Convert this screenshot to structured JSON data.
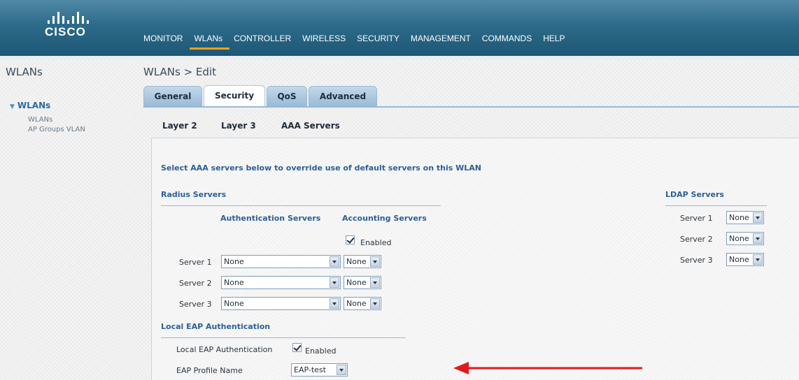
{
  "brand": {
    "logo_text": "CISCO"
  },
  "nav": [
    {
      "label": "MONITOR"
    },
    {
      "label": "WLANs",
      "active": true
    },
    {
      "label": "CONTROLLER"
    },
    {
      "label": "WIRELESS"
    },
    {
      "label": "SECURITY"
    },
    {
      "label": "MANAGEMENT"
    },
    {
      "label": "COMMANDS"
    },
    {
      "label": "HELP"
    }
  ],
  "sidebar": {
    "title": "WLANs",
    "group_label": "WLANs",
    "items": [
      {
        "label": "WLANs"
      },
      {
        "label": "AP Groups VLAN"
      }
    ]
  },
  "page": {
    "title": "WLANs > Edit"
  },
  "tabs": [
    {
      "label": "General"
    },
    {
      "label": "Security",
      "active": true
    },
    {
      "label": "QoS"
    },
    {
      "label": "Advanced"
    }
  ],
  "subtabs": [
    {
      "label": "Layer 2"
    },
    {
      "label": "Layer 3"
    },
    {
      "label": "AAA Servers",
      "active": true
    }
  ],
  "aaa": {
    "intro": "Select AAA servers below to override use of default servers on this WLAN",
    "radius_heading": "Radius Servers",
    "auth_header": "Authentication Servers",
    "acct_header": "Accounting Servers",
    "acct_enabled_label": "Enabled",
    "radius_rows": [
      {
        "label": "Server 1",
        "auth": "None",
        "acct": "None"
      },
      {
        "label": "Server 2",
        "auth": "None",
        "acct": "None"
      },
      {
        "label": "Server 3",
        "auth": "None",
        "acct": "None"
      }
    ],
    "ldap_heading": "LDAP Servers",
    "ldap_rows": [
      {
        "label": "Server 1",
        "value": "None"
      },
      {
        "label": "Server 2",
        "value": "None"
      },
      {
        "label": "Server 3",
        "value": "None"
      }
    ],
    "local_eap_heading": "Local EAP Authentication",
    "local_eap_label": "Local EAP Authentication",
    "local_eap_enabled_label": "Enabled",
    "eap_profile_label": "EAP Profile Name",
    "eap_profile_value": "EAP-test"
  },
  "colors": {
    "header": "#2c6a89",
    "active_nav_underline": "#f0a21e",
    "section_blue": "#2c5f97",
    "annotation_arrow": "#e11b1b"
  }
}
